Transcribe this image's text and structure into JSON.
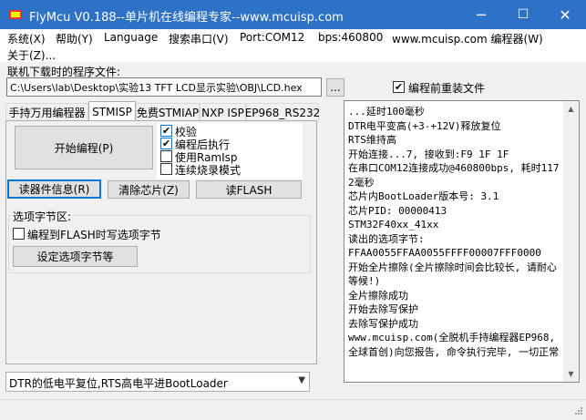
{
  "window": {
    "title": "FlyMcu V0.188--单片机在线编程专家--www.mcuisp.com",
    "minimize": "─",
    "maximize": "☐",
    "close": "✕"
  },
  "menu": {
    "row1": [
      "系统(X)",
      "帮助(Y)",
      "Language",
      "搜索串口(V)",
      "Port:COM12",
      "bps:460800",
      "www.mcuisp.com 编程器(W)"
    ],
    "row2": [
      "关于(Z)..."
    ]
  },
  "file": {
    "label": "联机下载时的程序文件:",
    "path": "C:\\Users\\lab\\Desktop\\实验13 TFT LCD显示实验\\OBJ\\LCD.hex",
    "browse": "...",
    "reload_label": "编程前重装文件",
    "reload_checked": true
  },
  "tabs": [
    "手持万用编程器",
    "STMISP",
    "免费STMIAP",
    "NXP ISP",
    "EP968_RS232"
  ],
  "active_tab": "STMISP",
  "stmisp": {
    "start_button": "开始编程(P)",
    "options": [
      {
        "label": "校验",
        "checked": true
      },
      {
        "label": "编程后执行",
        "checked": true
      },
      {
        "label": "使用RamIsp",
        "checked": false
      },
      {
        "label": "连续烧录模式",
        "checked": false
      }
    ],
    "read_info_button": "读器件信息(R)",
    "clear_chip_button": "清除芯片(Z)",
    "read_flash_button": "读FLASH",
    "option_byte": {
      "title": "选项字节区:",
      "write_label": "编程到FLASH时写选项字节",
      "write_checked": false,
      "set_button": "设定选项字节等"
    }
  },
  "bootmode": {
    "selected": "DTR的低电平复位,RTS高电平进BootLoader"
  },
  "log": {
    "text": "...延时100毫秒\nDTR电平变高(+3-+12V)释放复位\nRTS维持高\n开始连接...7, 接收到:F9 1F 1F\n在串口COM12连接成功@460800bps, 耗时1172毫秒\n芯片内BootLoader版本号: 3.1\n芯片PID: 00000413\nSTM32F40xx_41xx\n读出的选项字节:\nFFAA0055FFAA0055FFFF00007FFF0000\n开始全片擦除(全片擦除时间会比较长, 请耐心等候!)\n全片擦除成功\n开始去除写保护\n去除写保护成功\nwww.mcuisp.com(全脱机手持编程器EP968,全球首创)向您报告, 命令执行完毕, 一切正常"
  },
  "colors": {
    "titlebar": "#2d72c6",
    "focus": "#0078d7"
  }
}
